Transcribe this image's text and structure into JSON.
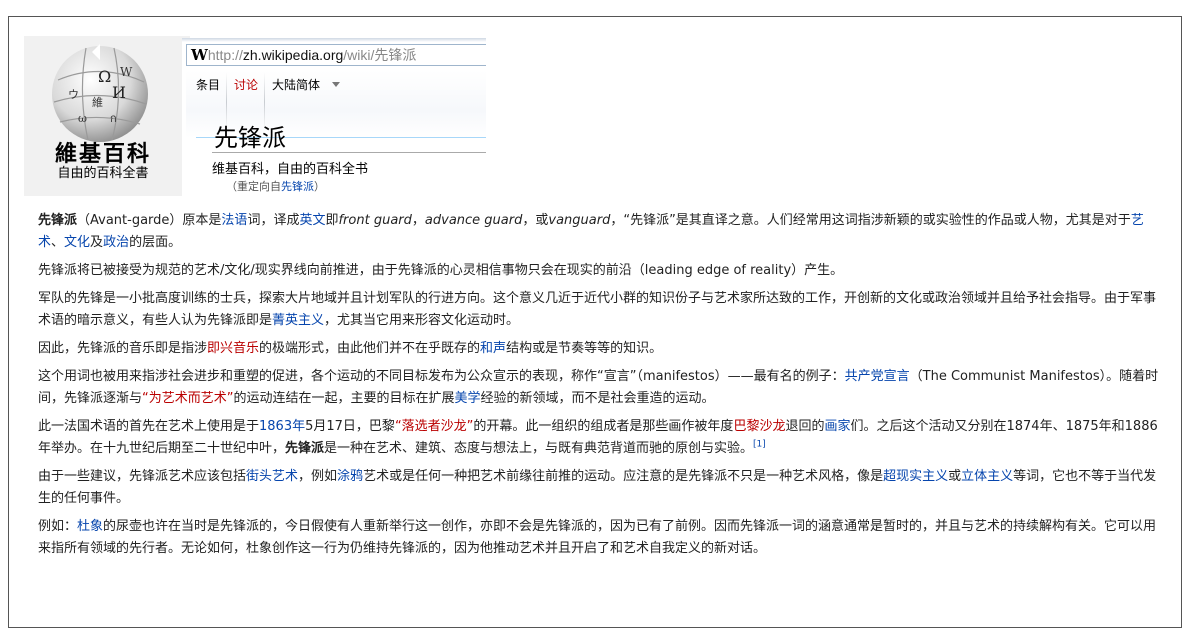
{
  "logo": {
    "title": "維基百科",
    "subtitle": "自由的百科全書"
  },
  "browser": {
    "favicon": "W",
    "url_proto": "http://",
    "url_host": "zh.wikipedia.org",
    "url_path": "/wiki/先锋派",
    "tabs": [
      "条目",
      "讨论",
      "大陆简体"
    ],
    "page_title": "先锋派",
    "site_subtitle": "维基百科，自由的百科全书",
    "redirect_prefix": "（重定向自",
    "redirect_link": "先锋派",
    "redirect_suffix": "）"
  },
  "paragraphs": [
    [
      {
        "t": "先锋派",
        "b": true
      },
      {
        "t": "（Avant-garde）原本是"
      },
      {
        "t": "法语",
        "link": true
      },
      {
        "t": "词，译成"
      },
      {
        "t": "英文",
        "link": true
      },
      {
        "t": "即"
      },
      {
        "t": "front guard",
        "i": true
      },
      {
        "t": "，"
      },
      {
        "t": "advance guard",
        "i": true
      },
      {
        "t": "，或"
      },
      {
        "t": "vanguard",
        "i": true
      },
      {
        "t": "，“先锋派”是其直译之意。人们经常用这词指涉新颖的或实验性的作品或人物，尤其是对于"
      },
      {
        "t": "艺术",
        "link": true
      },
      {
        "t": "、"
      },
      {
        "t": "文化",
        "link": true
      },
      {
        "t": "及"
      },
      {
        "t": "政治",
        "link": true
      },
      {
        "t": "的层面。"
      }
    ],
    [
      {
        "t": "先锋派将已被接受为规范的艺术/文化/现实界线向前推进，由于先锋派的心灵相信事物只会在现实的前沿（leading edge of reality）产生。"
      }
    ],
    [
      {
        "t": "军队的先锋是一小批高度训练的士兵，探索大片地域并且计划军队的行进方向。这个意义几近于近代小群的知识份子与艺术家所达致的工作，开创新的文化或政治领域并且给予社会指导。由于军事术语的暗示意义，有些人认为先锋派即是"
      },
      {
        "t": "菁英主义",
        "link": true
      },
      {
        "t": "，尤其当它用来形容文化运动时。"
      }
    ],
    [
      {
        "t": "因此，先锋派的音乐即是指涉"
      },
      {
        "t": "即兴音乐",
        "link": true,
        "red": true
      },
      {
        "t": "的极端形式，由此他们并不在乎既存的"
      },
      {
        "t": "和声",
        "link": true
      },
      {
        "t": "结构或是节奏等等的知识。"
      }
    ],
    [
      {
        "t": "这个用词也被用来指涉社会进步和重塑的促进，各个运动的不同目标发布为公众宣示的表现，称作“宣言”（manifestos）——最有名的例子："
      },
      {
        "t": "共产党宣言",
        "link": true
      },
      {
        "t": "（The Communist Manifestos）。随着时间，先锋派逐渐与"
      },
      {
        "t": "“为艺术而艺术”",
        "link": true,
        "red": true
      },
      {
        "t": "的运动连结在一起，主要的目标在扩展"
      },
      {
        "t": "美学",
        "link": true
      },
      {
        "t": "经验的新领域，而不是社会重造的运动。"
      }
    ],
    [
      {
        "t": "此一法国术语的首先在艺术上使用是于"
      },
      {
        "t": "1863年",
        "link": true
      },
      {
        "t": "5月17日，巴黎"
      },
      {
        "t": "“落选者沙龙”",
        "link": true,
        "red": true
      },
      {
        "t": "的开幕。此一组织的组成者是那些画作被年度"
      },
      {
        "t": "巴黎沙龙",
        "link": true,
        "red": true
      },
      {
        "t": "退回的"
      },
      {
        "t": "画家",
        "link": true
      },
      {
        "t": "们。之后这个活动又分别在1874年、1875年和1886年举办。在十九世纪后期至二十世纪中叶，"
      },
      {
        "t": "先锋派",
        "b": true
      },
      {
        "t": "是一种在艺术、建筑、态度与想法上，与既有典范背道而驰的原创与实验。"
      },
      {
        "t": "[1]",
        "link": true,
        "sup": true
      }
    ],
    [
      {
        "t": "由于一些建议，先锋派艺术应该包括"
      },
      {
        "t": "街头艺术",
        "link": true
      },
      {
        "t": "，例如"
      },
      {
        "t": "涂鸦",
        "link": true
      },
      {
        "t": "艺术或是任何一种把艺术前缘往前推的运动。应注意的是先锋派不只是一种艺术风格，像是"
      },
      {
        "t": "超现实主义",
        "link": true
      },
      {
        "t": "或"
      },
      {
        "t": "立体主义",
        "link": true
      },
      {
        "t": "等词，它也不等于当代发生的任何事件。"
      }
    ],
    [
      {
        "t": "例如："
      },
      {
        "t": "杜象",
        "link": true
      },
      {
        "t": "的尿壶也许在当时是先锋派的，今日假使有人重新举行这一创作，亦即不会是先锋派的，因为已有了前例。因而先锋派一词的涵意通常是暂时的，并且与艺术的持续解构有关。它可以用来指所有领域的先行者。无论如何，杜象创作这一行为仍维持先锋派的，因为他推动艺术并且开启了和艺术自我定义的新对话。"
      }
    ]
  ],
  "colors": {
    "link": "#0645ad",
    "redlink": "#ba0000",
    "text": "#222222"
  }
}
